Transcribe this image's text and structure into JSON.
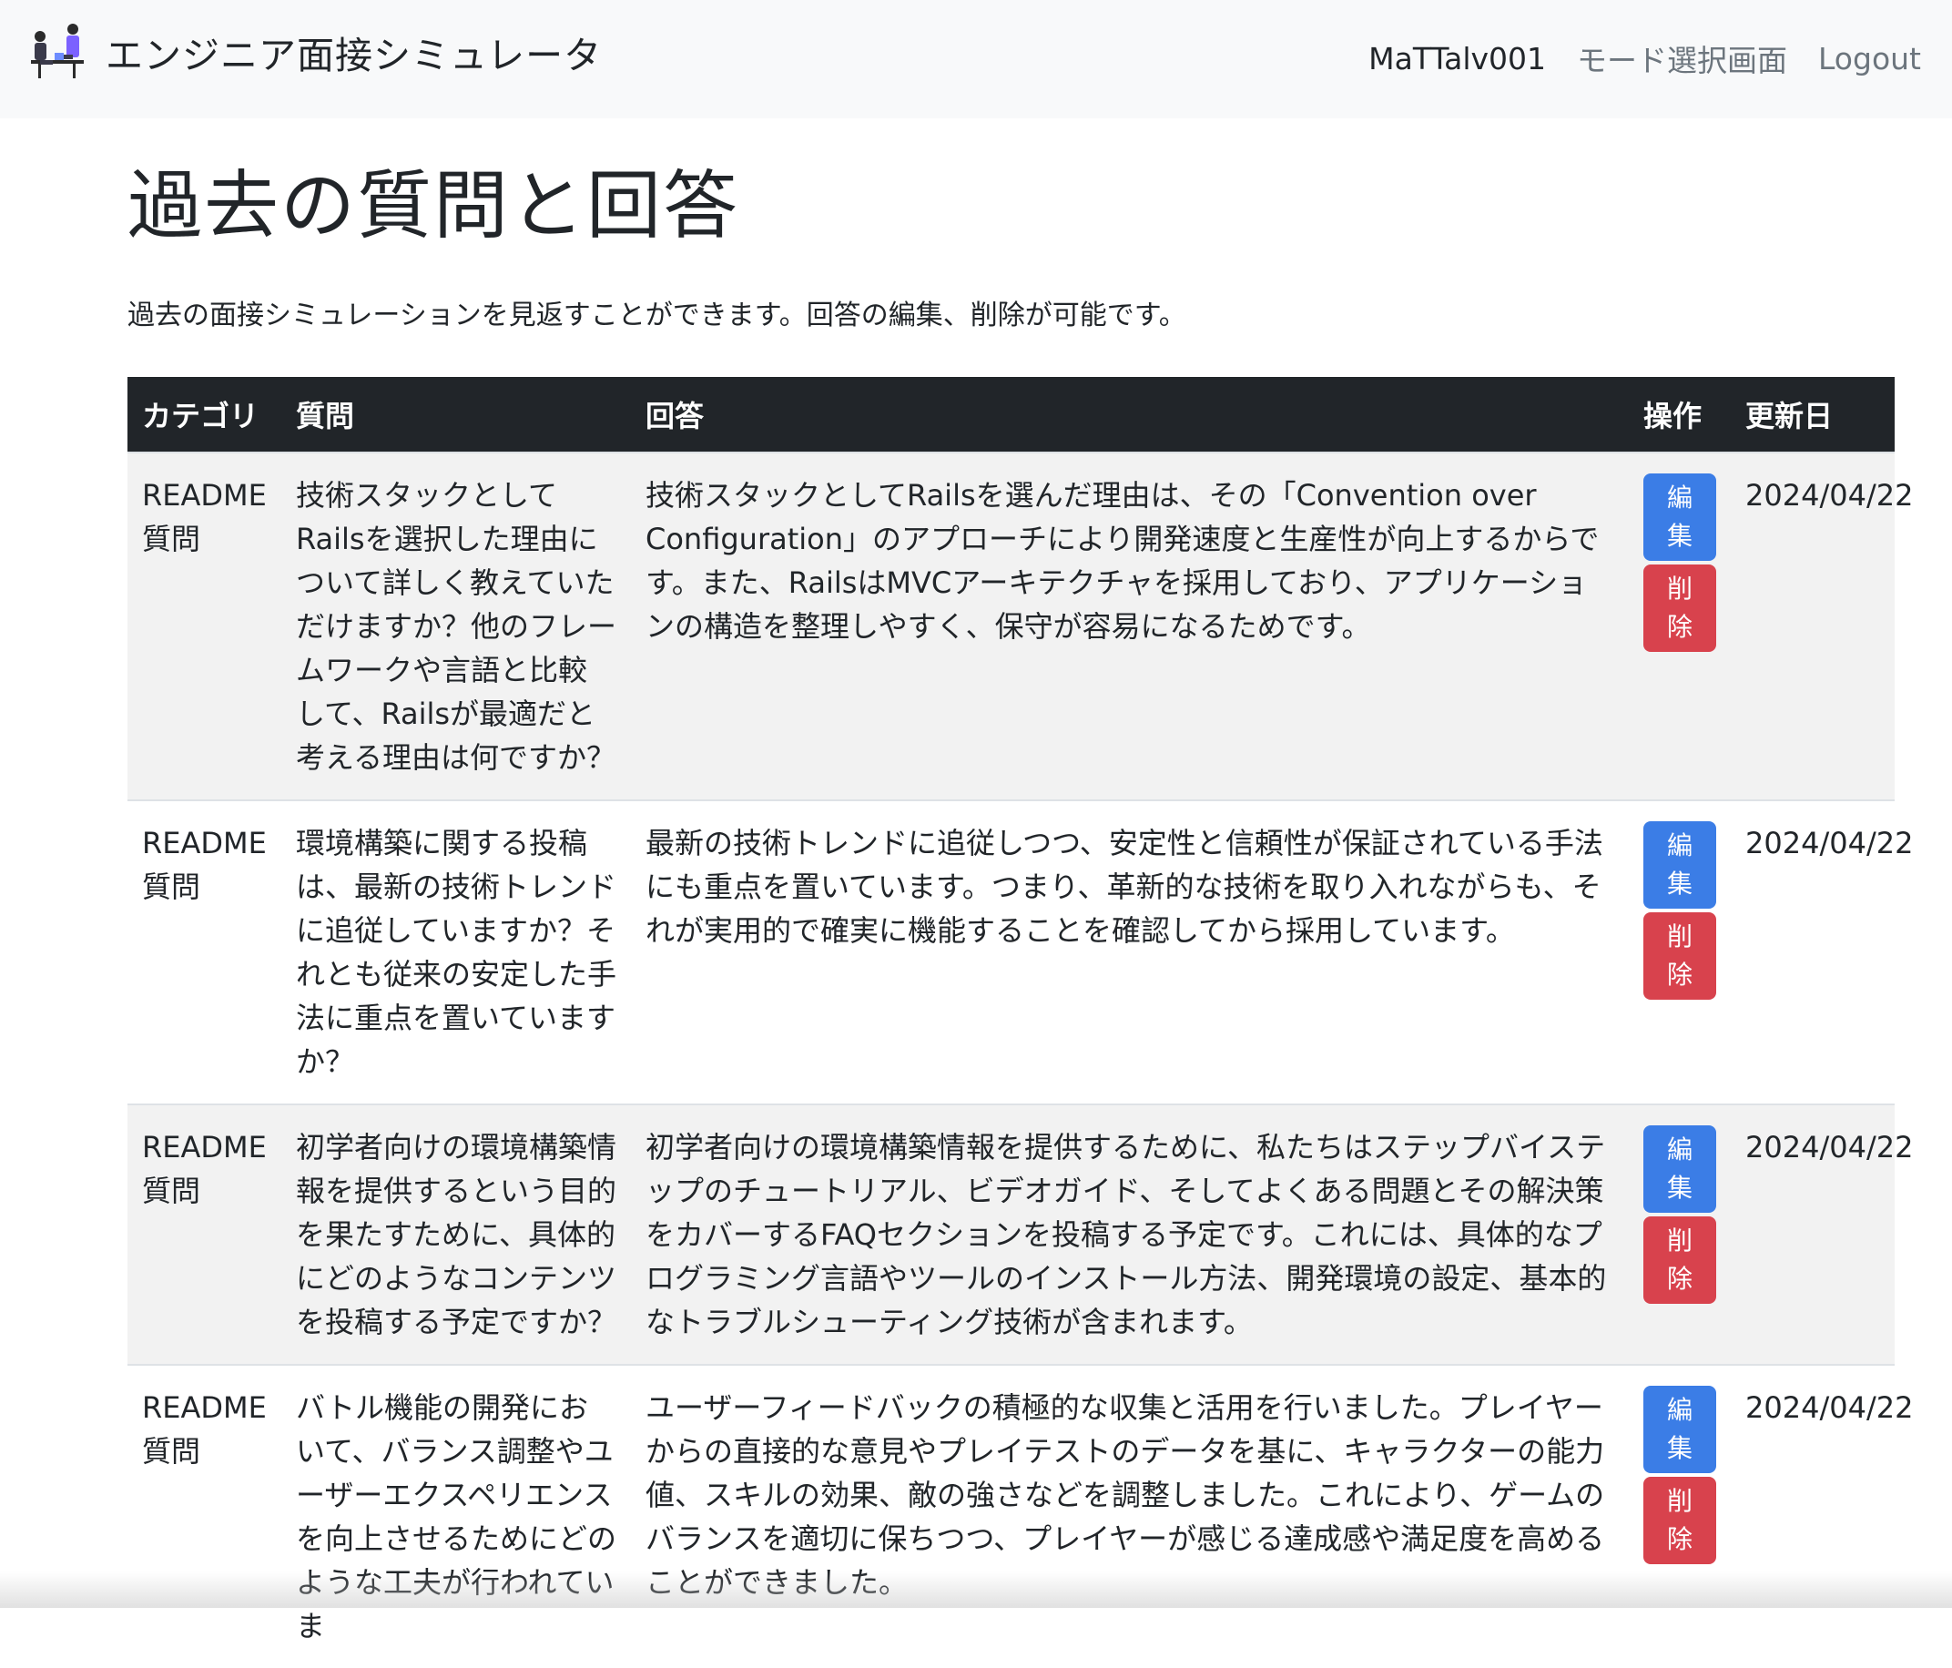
{
  "navbar": {
    "brand": "エンジニア面接シミュレータ",
    "logo_icon": "interview-people-icon",
    "user": "MaTTalv001",
    "mode_link": "モード選択画面",
    "logout": "Logout"
  },
  "page": {
    "title": "過去の質問と回答",
    "lead": "過去の面接シミュレーションを見返すことができます。回答の編集、削除が可能です。"
  },
  "table": {
    "headers": {
      "category": "カテゴリ",
      "question": "質問",
      "answer": "回答",
      "ops": "操作",
      "updated": "更新日"
    },
    "edit_label": [
      "編",
      "集"
    ],
    "delete_label": [
      "削",
      "除"
    ],
    "rows": [
      {
        "category": "README質問",
        "question": "技術スタックとしてRailsを選択した理由について詳しく教えていただけますか？他のフレームワークや言語と比較して、Railsが最適だと考える理由は何ですか？",
        "answer": "技術スタックとしてRailsを選んだ理由は、その「Convention over Configuration」のアプローチにより開発速度と生産性が向上するからです。また、RailsはMVCアーキテクチャを採用しており、アプリケーションの構造を整理しやすく、保守が容易になるためです。",
        "updated": "2024/04/22"
      },
      {
        "category": "README質問",
        "question": "環境構築に関する投稿は、最新の技術トレンドに追従していますか？それとも従来の安定した手法に重点を置いていますか？",
        "answer": "最新の技術トレンドに追従しつつ、安定性と信頼性が保証されている手法にも重点を置いています。つまり、革新的な技術を取り入れながらも、それが実用的で確実に機能することを確認してから採用しています。",
        "updated": "2024/04/22"
      },
      {
        "category": "README質問",
        "question": "初学者向けの環境構築情報を提供するという目的を果たすために、具体的にどのようなコンテンツを投稿する予定ですか？",
        "answer": "初学者向けの環境構築情報を提供するために、私たちはステップバイステップのチュートリアル、ビデオガイド、そしてよくある問題とその解決策をカバーするFAQセクションを投稿する予定です。これには、具体的なプログラミング言語やツールのインストール方法、開発環境の設定、基本的なトラブルシューティング技術が含まれます。",
        "updated": "2024/04/22"
      },
      {
        "category": "README質問",
        "question": "バトル機能の開発において、バランス調整やユーザーエクスペリエンスを向上させるためにどのような工夫が行われていま",
        "answer": "ユーザーフィードバックの積極的な収集と活用を行いました。プレイヤーからの直接的な意見やプレイテストのデータを基に、キャラクターの能力値、スキルの効果、敵の強さなどを調整しました。これにより、ゲームのバランスを適切に保ちつつ、プレイヤーが感じる達成感や満足度を高めることができました。",
        "updated": "2024/04/22"
      }
    ]
  }
}
